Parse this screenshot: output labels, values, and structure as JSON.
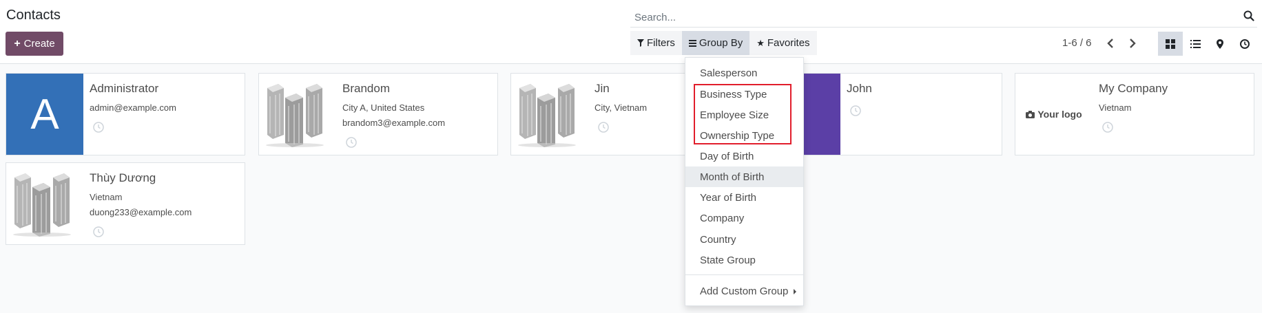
{
  "header": {
    "title": "Contacts",
    "create_label": "Create"
  },
  "search": {
    "placeholder": "Search..."
  },
  "filter_bar": {
    "filters_label": "Filters",
    "group_by_label": "Group By",
    "favorites_label": "Favorites"
  },
  "pager": {
    "text": "1-6 / 6"
  },
  "cards": [
    {
      "name": "Administrator",
      "line1": "admin@example.com",
      "line2": "",
      "avatar_letter": "A"
    },
    {
      "name": "Brandom",
      "line1": "City A, United States",
      "line2": "brandom3@example.com"
    },
    {
      "name": "Jin",
      "line1": "City, Vietnam",
      "line2": ""
    },
    {
      "name": "John",
      "line1": "",
      "line2": ""
    },
    {
      "name": "My Company",
      "line1": "Vietnam",
      "line2": "",
      "logo_text": "Your logo"
    },
    {
      "name": "Thùy Dương",
      "line1": "Vietnam",
      "line2": "duong233@example.com"
    }
  ],
  "group_by_menu": {
    "items": [
      "Salesperson",
      "Business Type",
      "Employee Size",
      "Ownership Type",
      "Day of Birth",
      "Month of Birth",
      "Year of Birth",
      "Company",
      "Country",
      "State Group"
    ],
    "custom_label": "Add Custom Group"
  },
  "colors": {
    "brand": "#714b67",
    "avatar_blue": "#3370b7",
    "avatar_purple": "#5b3fa6",
    "highlight": "#e11d2b"
  }
}
